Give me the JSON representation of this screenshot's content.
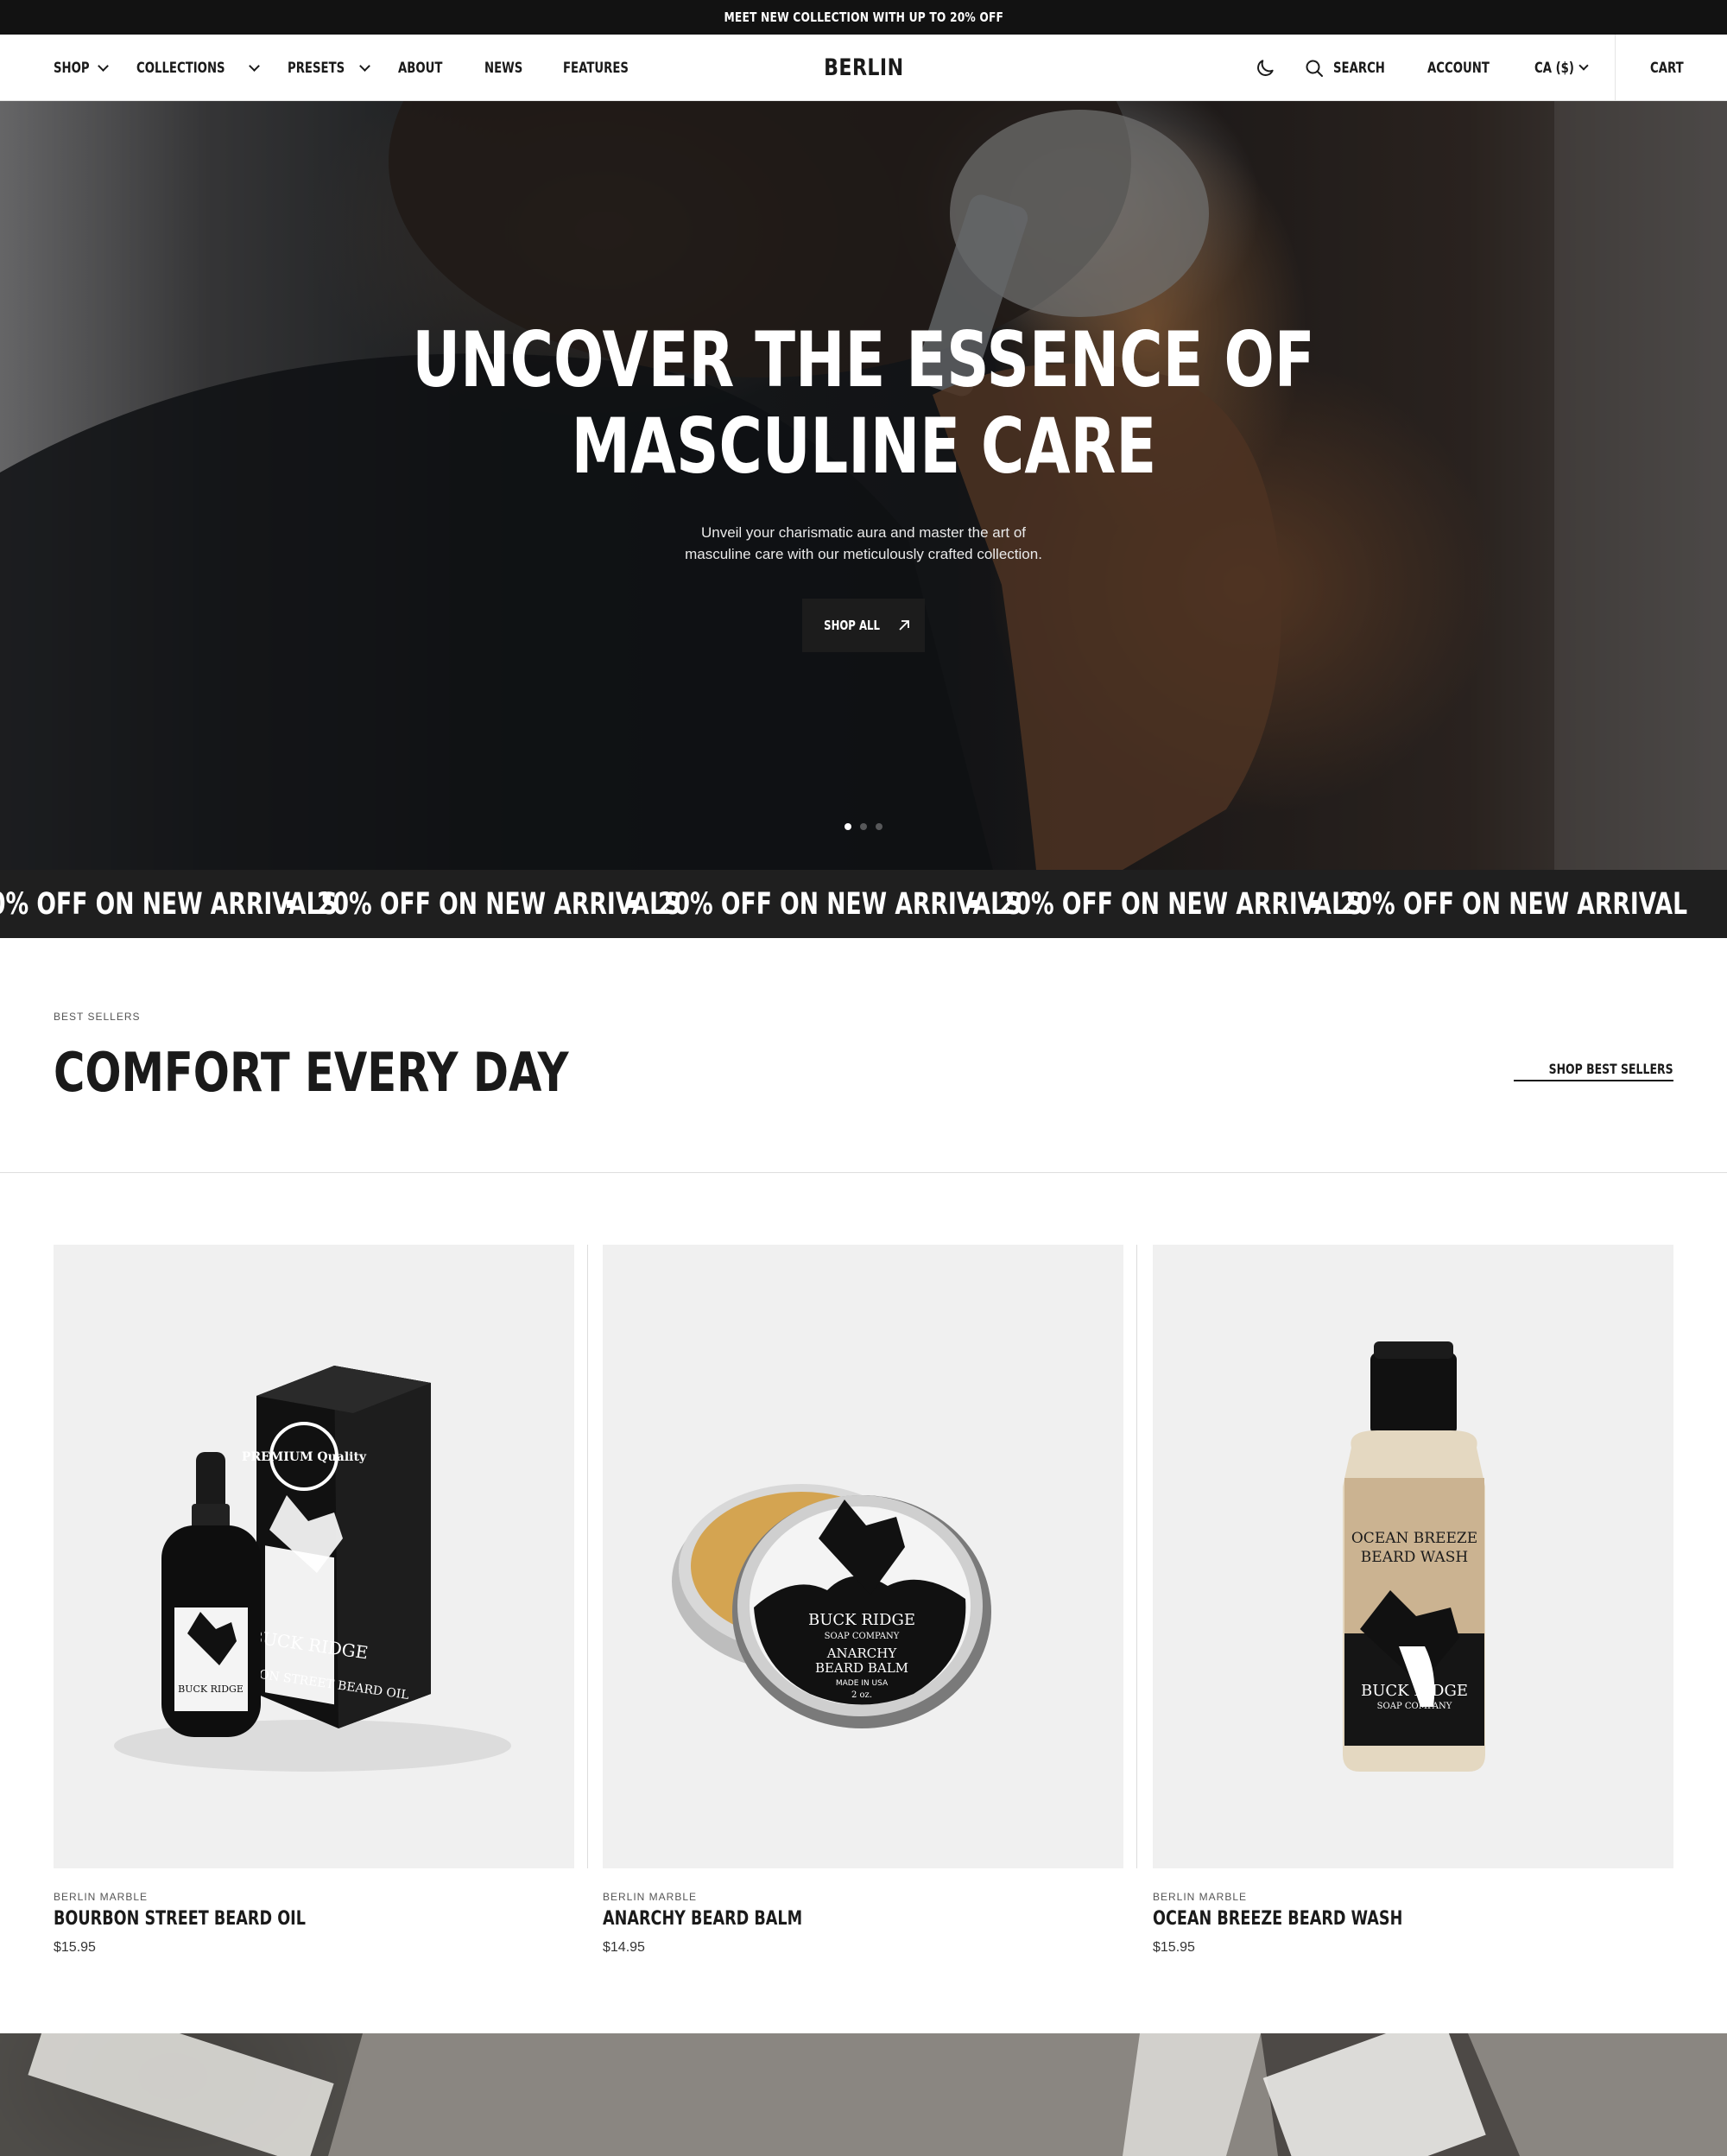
{
  "announcement": "MEET NEW COLLECTION WITH UP TO 20% OFF",
  "header": {
    "brand": "BERLIN",
    "nav": [
      {
        "label": "SHOP",
        "caret": true
      },
      {
        "label": "COLLECTIONS",
        "caret": true
      },
      {
        "label": "PRESETS",
        "caret": true
      },
      {
        "label": "ABOUT",
        "caret": false
      },
      {
        "label": "NEWS",
        "caret": false
      },
      {
        "label": "FEATURES",
        "caret": false
      }
    ],
    "search_label": "SEARCH",
    "account_label": "ACCOUNT",
    "currency_label": "CA ($)",
    "cart_label": "CART",
    "theme_icon": "moon-icon"
  },
  "hero": {
    "title_line1": "UNCOVER THE ESSENCE OF",
    "title_line2": "MASCULINE CARE",
    "subtitle_line1": "Unveil your charismatic aura and master the art of",
    "subtitle_line2": "masculine care with our meticulously crafted collection.",
    "button_label": "SHOP ALL",
    "slides": 3,
    "active_slide": 1
  },
  "marquee": {
    "text": "20% OFF ON NEW ARRIVALS",
    "first_visible": "0% OFF ON NEW ARRIVALS",
    "last_visible": "20% OFF ON NEW ARRIVAL"
  },
  "best_sellers": {
    "eyebrow": "BEST SELLERS",
    "title": "COMFORT EVERY DAY",
    "link_label": "SHOP BEST SELLERS",
    "products": [
      {
        "vendor": "BERLIN MARBLE",
        "name": "BOURBON STREET BEARD OIL",
        "price": "$15.95"
      },
      {
        "vendor": "BERLIN MARBLE",
        "name": "ANARCHY BEARD BALM",
        "price": "$14.95"
      },
      {
        "vendor": "BERLIN MARBLE",
        "name": "OCEAN BREEZE BEARD WASH",
        "price": "$15.95"
      }
    ]
  },
  "product_labels": {
    "oil_box_badge": "PREMIUM Quality",
    "brand_line1": "BUCK RIDGE",
    "brand_line2": "SOAP COMPANY",
    "oil_name": "BOURBON STREET BEARD OIL",
    "balm_name1": "ANARCHY",
    "balm_name2": "BEARD BALM",
    "balm_made": "MADE IN USA",
    "balm_size": "2 oz.",
    "wash_name1": "OCEAN BREEZE",
    "wash_name2": "BEARD WASH"
  },
  "colors": {
    "dark": "#121212",
    "accent": "#1c1c1c",
    "card_bg": "#f0f0f0"
  }
}
